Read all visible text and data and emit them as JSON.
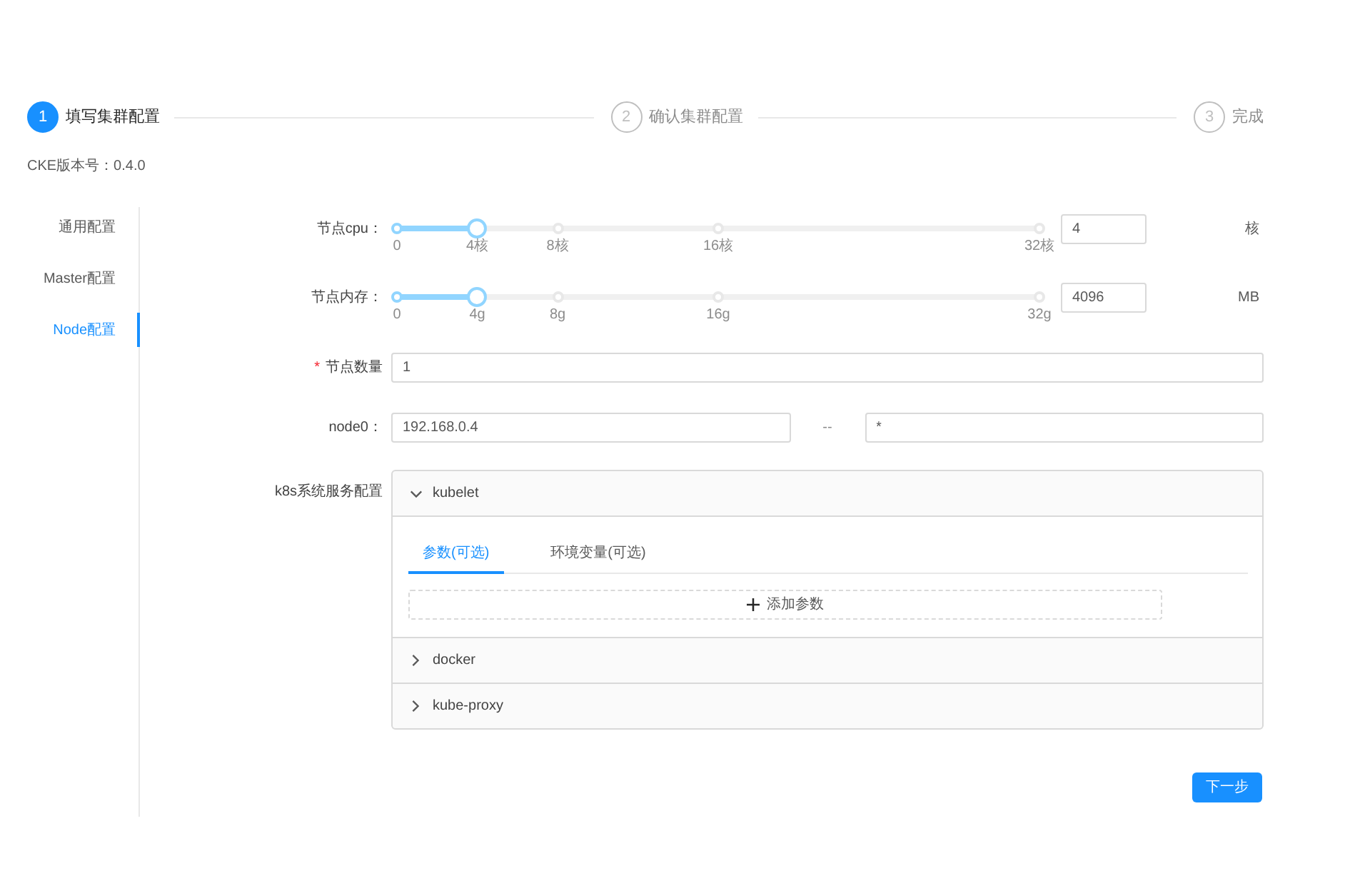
{
  "steps": [
    {
      "number": "1",
      "title": "填写集群配置",
      "active": true
    },
    {
      "number": "2",
      "title": "确认集群配置",
      "active": false
    },
    {
      "number": "3",
      "title": "完成",
      "active": false
    }
  ],
  "version": "CKE版本号：0.4.0",
  "sidebar": {
    "items": [
      {
        "label": "通用配置",
        "selected": false
      },
      {
        "label": "Master配置",
        "selected": false
      },
      {
        "label": "Node配置",
        "selected": true
      }
    ]
  },
  "form": {
    "sliders": [
      {
        "label": "节点cpu：",
        "level": 0.125,
        "marks": [
          "0",
          "4核",
          "8核",
          "16核",
          "32核"
        ],
        "value": "4",
        "unit": "核"
      },
      {
        "label": "节点内存：",
        "level": 0.125,
        "marks": [
          "0",
          "4g",
          "8g",
          "16g",
          "32g"
        ],
        "value": "4096",
        "unit": "MB"
      }
    ],
    "node_count": {
      "required_mark": "*",
      "label": "节点数量",
      "value": "1"
    },
    "nodes": [
      {
        "label": "node0：",
        "address": "192.168.0.4",
        "separator": "--",
        "value_2": "*"
      }
    ],
    "services": {
      "label": "k8s系统服务配置",
      "panels": [
        {
          "title": "kubelet",
          "expanded": true,
          "tabs": [
            {
              "label": "参数(可选)",
              "selected": true
            },
            {
              "label": "环境变量(可选)",
              "selected": false
            }
          ],
          "add_button": "添加参数"
        },
        {
          "title": "docker",
          "expanded": false
        },
        {
          "title": "kube-proxy",
          "expanded": false
        }
      ]
    }
  },
  "next_button": "下一步"
}
